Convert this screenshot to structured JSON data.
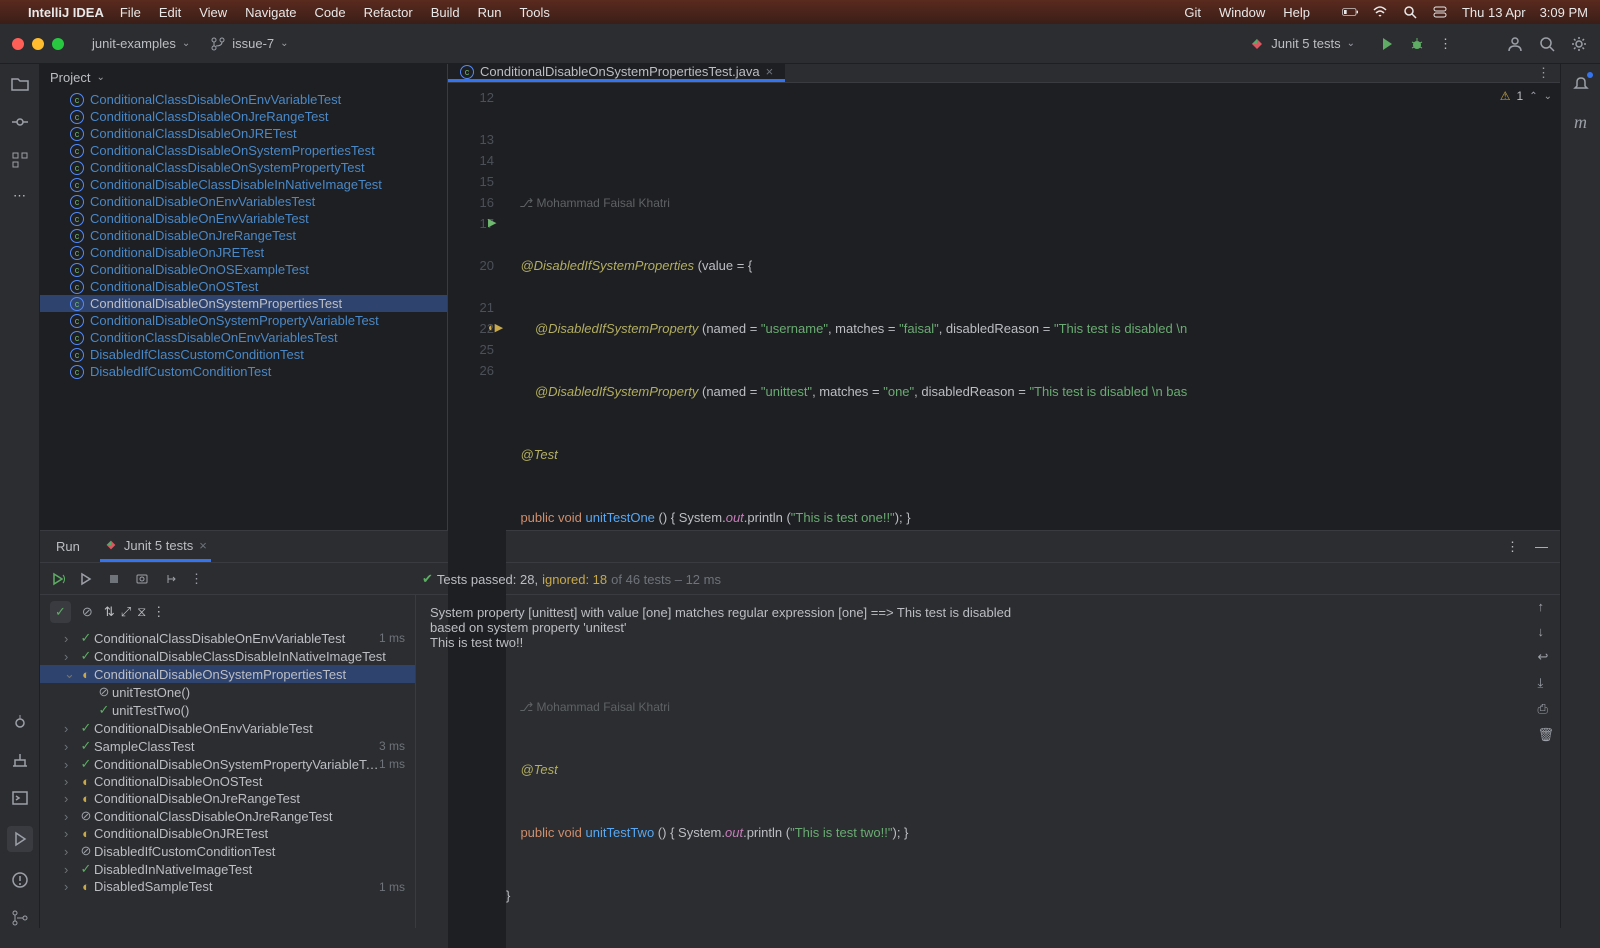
{
  "menubar": {
    "app": "IntelliJ IDEA",
    "items": [
      "File",
      "Edit",
      "View",
      "Navigate",
      "Code",
      "Refactor",
      "Build",
      "Run",
      "Tools"
    ],
    "right_items": [
      "Git",
      "Window",
      "Help"
    ],
    "date": "Thu 13 Apr",
    "time": "3:09 PM"
  },
  "toolbar": {
    "project": "junit-examples",
    "branch": "issue-7",
    "run_config": "Junit 5 tests"
  },
  "project_panel": {
    "title": "Project",
    "files": [
      "ConditionalClassDisableOnEnvVariableTest",
      "ConditionalClassDisableOnJreRangeTest",
      "ConditionalClassDisableOnJRETest",
      "ConditionalClassDisableOnSystemPropertiesTest",
      "ConditionalClassDisableOnSystemPropertyTest",
      "ConditionalDisableClassDisableInNativeImageTest",
      "ConditionalDisableOnEnvVariablesTest",
      "ConditionalDisableOnEnvVariableTest",
      "ConditionalDisableOnJreRangeTest",
      "ConditionalDisableOnJRETest",
      "ConditionalDisableOnOSExampleTest",
      "ConditionalDisableOnOSTest",
      "ConditionalDisableOnSystemPropertiesTest",
      "ConditionalDisableOnSystemPropertyVariableTest",
      "ConditionClassDisableOnEnvVariablesTest",
      "DisabledIfClassCustomConditionTest",
      "DisabledIfCustomConditionTest"
    ],
    "selected_index": 12
  },
  "editor": {
    "tab": "ConditionalDisableOnSystemPropertiesTest.java",
    "inspection_count": "1",
    "author": "Mohammad Faisal Khatri",
    "lines": {
      "l12": "12",
      "l13": "13",
      "l14": "14",
      "l15": "15",
      "l16": "16",
      "l17": "17",
      "l20": "20",
      "l21": "21",
      "l22": "22",
      "l25": "25",
      "l26": "26"
    },
    "code": {
      "anno1": "@DisabledIfSystemProperties",
      "anno1_tail": " (value = {",
      "anno2": "@DisabledIfSystemProperty",
      "l14_tail": " (named = \"username\", matches = \"faisal\", disabledReason = \"This test is disabled \\n",
      "l15_tail": " (named = \"unittest\", matches = \"one\", disabledReason = \"This test is disabled \\n bas",
      "test": "@Test",
      "pub": "public",
      "void": "void",
      "m1": "unitTestOne",
      "m2": "unitTestTwo",
      "sys": "System",
      "out": "out",
      "println": "println",
      "s1": "\"This is test one!!\"",
      "s2": "\"This is test two!!\"",
      "tail": " () { ",
      "mid": ".",
      "open": " (",
      "close": "); }"
    }
  },
  "run": {
    "tab_label_run": "Run",
    "tab_label": "Junit 5 tests",
    "summary_prefix": "Tests passed: 28,",
    "summary_ignored": " ignored: 18",
    "summary_suffix": " of 46 tests – 12 ms",
    "tests": [
      {
        "name": "ConditionalClassDisableOnEnvVariableTest",
        "status": "pass",
        "indent": 1,
        "arrow": true,
        "time": "1 ms",
        "cut": true
      },
      {
        "name": "ConditionalDisableClassDisableInNativeImageTest",
        "status": "pass",
        "indent": 1,
        "arrow": true
      },
      {
        "name": "ConditionalDisableOnSystemPropertiesTest",
        "status": "warn",
        "indent": 1,
        "arrow": true,
        "expanded": true,
        "selected": true
      },
      {
        "name": "unitTestOne()",
        "status": "ign",
        "indent": 2
      },
      {
        "name": "unitTestTwo()",
        "status": "pass",
        "indent": 2
      },
      {
        "name": "ConditionalDisableOnEnvVariableTest",
        "status": "pass",
        "indent": 1,
        "arrow": true
      },
      {
        "name": "SampleClassTest",
        "status": "pass",
        "indent": 1,
        "arrow": true,
        "time": "3 ms"
      },
      {
        "name": "ConditionalDisableOnSystemPropertyVariableTest",
        "status": "pass",
        "indent": 1,
        "arrow": true,
        "time": "1 ms",
        "cut": true
      },
      {
        "name": "ConditionalDisableOnOSTest",
        "status": "warn",
        "indent": 1,
        "arrow": true
      },
      {
        "name": "ConditionalDisableOnJreRangeTest",
        "status": "warn",
        "indent": 1,
        "arrow": true
      },
      {
        "name": "ConditionalClassDisableOnJreRangeTest",
        "status": "ign",
        "indent": 1,
        "arrow": true
      },
      {
        "name": "ConditionalDisableOnJRETest",
        "status": "warn",
        "indent": 1,
        "arrow": true
      },
      {
        "name": "DisabledIfCustomConditionTest",
        "status": "ign",
        "indent": 1,
        "arrow": true
      },
      {
        "name": "DisabledInNativeImageTest",
        "status": "pass",
        "indent": 1,
        "arrow": true
      },
      {
        "name": "DisabledSampleTest",
        "status": "warn",
        "indent": 1,
        "arrow": true,
        "time": "1 ms"
      }
    ],
    "console_line1": "System property [unittest] with value [one] matches regular expression [one] ==> This test is disabled",
    "console_line2": "based on system property 'unitest'",
    "console_line3": "This is test two!!"
  }
}
